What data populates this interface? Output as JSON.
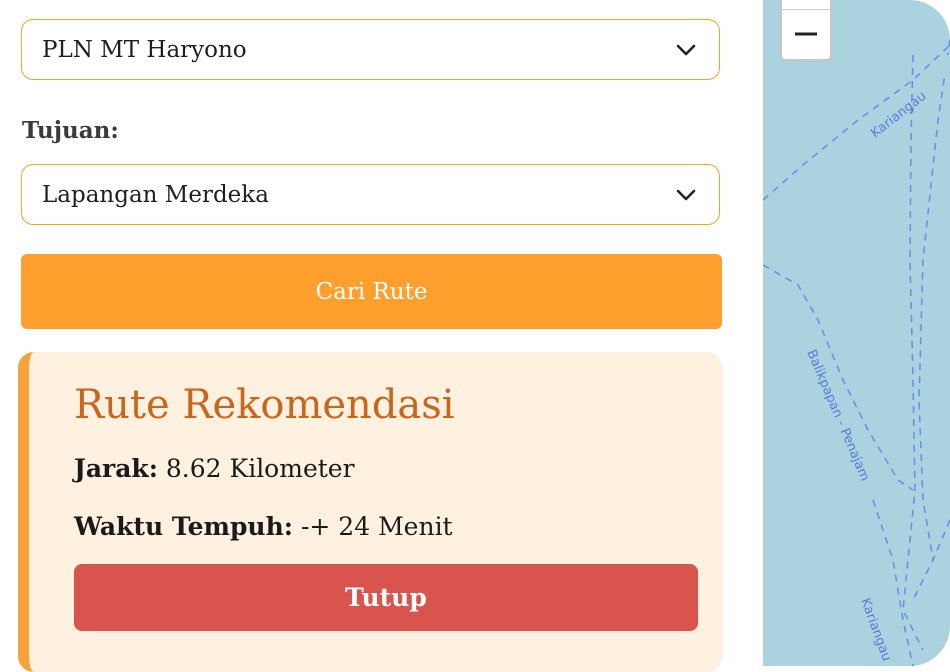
{
  "origin": {
    "selected": "PLN MT Haryono"
  },
  "destination": {
    "label": "Tujuan:",
    "selected": "Lapangan Merdeka"
  },
  "search_button": {
    "label": "Cari Rute"
  },
  "result": {
    "title": "Rute Rekomendasi",
    "distance_label": "Jarak:",
    "distance_value": "8.62 Kilometer",
    "time_label": "Waktu Tempuh:",
    "time_value": "-+ 24 Menit",
    "close_label": "Tutup"
  },
  "map": {
    "zoom_out_icon": "minus-icon",
    "labels": {
      "route_1": "Kariangau",
      "route_2": "Balikpapan - Penajam",
      "route_3": "Kariangau"
    }
  },
  "colors": {
    "accent": "#ff9f2e",
    "accent_border": "#f5a623",
    "card_bg": "#fef1df",
    "title": "#c8661e",
    "danger": "#d9534f",
    "map_water": "#aad3df",
    "route_line": "#6b8fe6"
  }
}
